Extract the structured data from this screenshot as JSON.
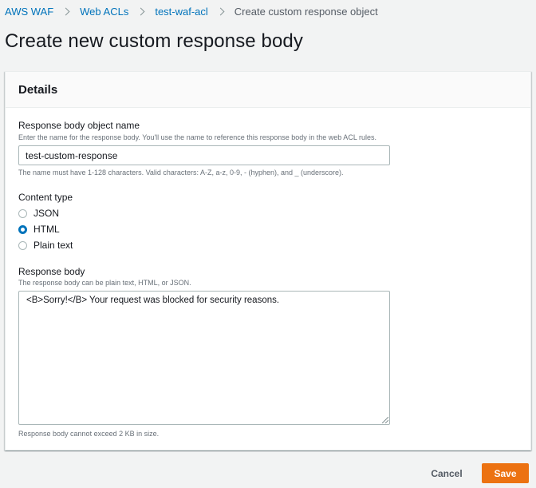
{
  "breadcrumb": {
    "items": [
      {
        "label": "AWS WAF"
      },
      {
        "label": "Web ACLs"
      },
      {
        "label": "test-waf-acl"
      }
    ],
    "current": "Create custom response object"
  },
  "page": {
    "title": "Create new custom response body"
  },
  "details": {
    "title": "Details",
    "name_field": {
      "label": "Response body object name",
      "description": "Enter the name for the response body. You'll use the name to reference this response body in the web ACL rules.",
      "value": "test-custom-response",
      "constraint": "The name must have 1-128 characters. Valid characters: A-Z, a-z, 0-9, - (hyphen), and _ (underscore)."
    },
    "content_type": {
      "label": "Content type",
      "options": [
        {
          "label": "JSON",
          "checked": false
        },
        {
          "label": "HTML",
          "checked": true
        },
        {
          "label": "Plain text",
          "checked": false
        }
      ]
    },
    "body_field": {
      "label": "Response body",
      "description": "The response body can be plain text, HTML, or JSON.",
      "value": "<B>Sorry!</B> Your request was blocked for security reasons.",
      "constraint": "Response body cannot exceed 2 KB in size."
    }
  },
  "actions": {
    "cancel_label": "Cancel",
    "save_label": "Save"
  },
  "colors": {
    "accent": "#0073bb",
    "primary_button": "#ec7211"
  }
}
